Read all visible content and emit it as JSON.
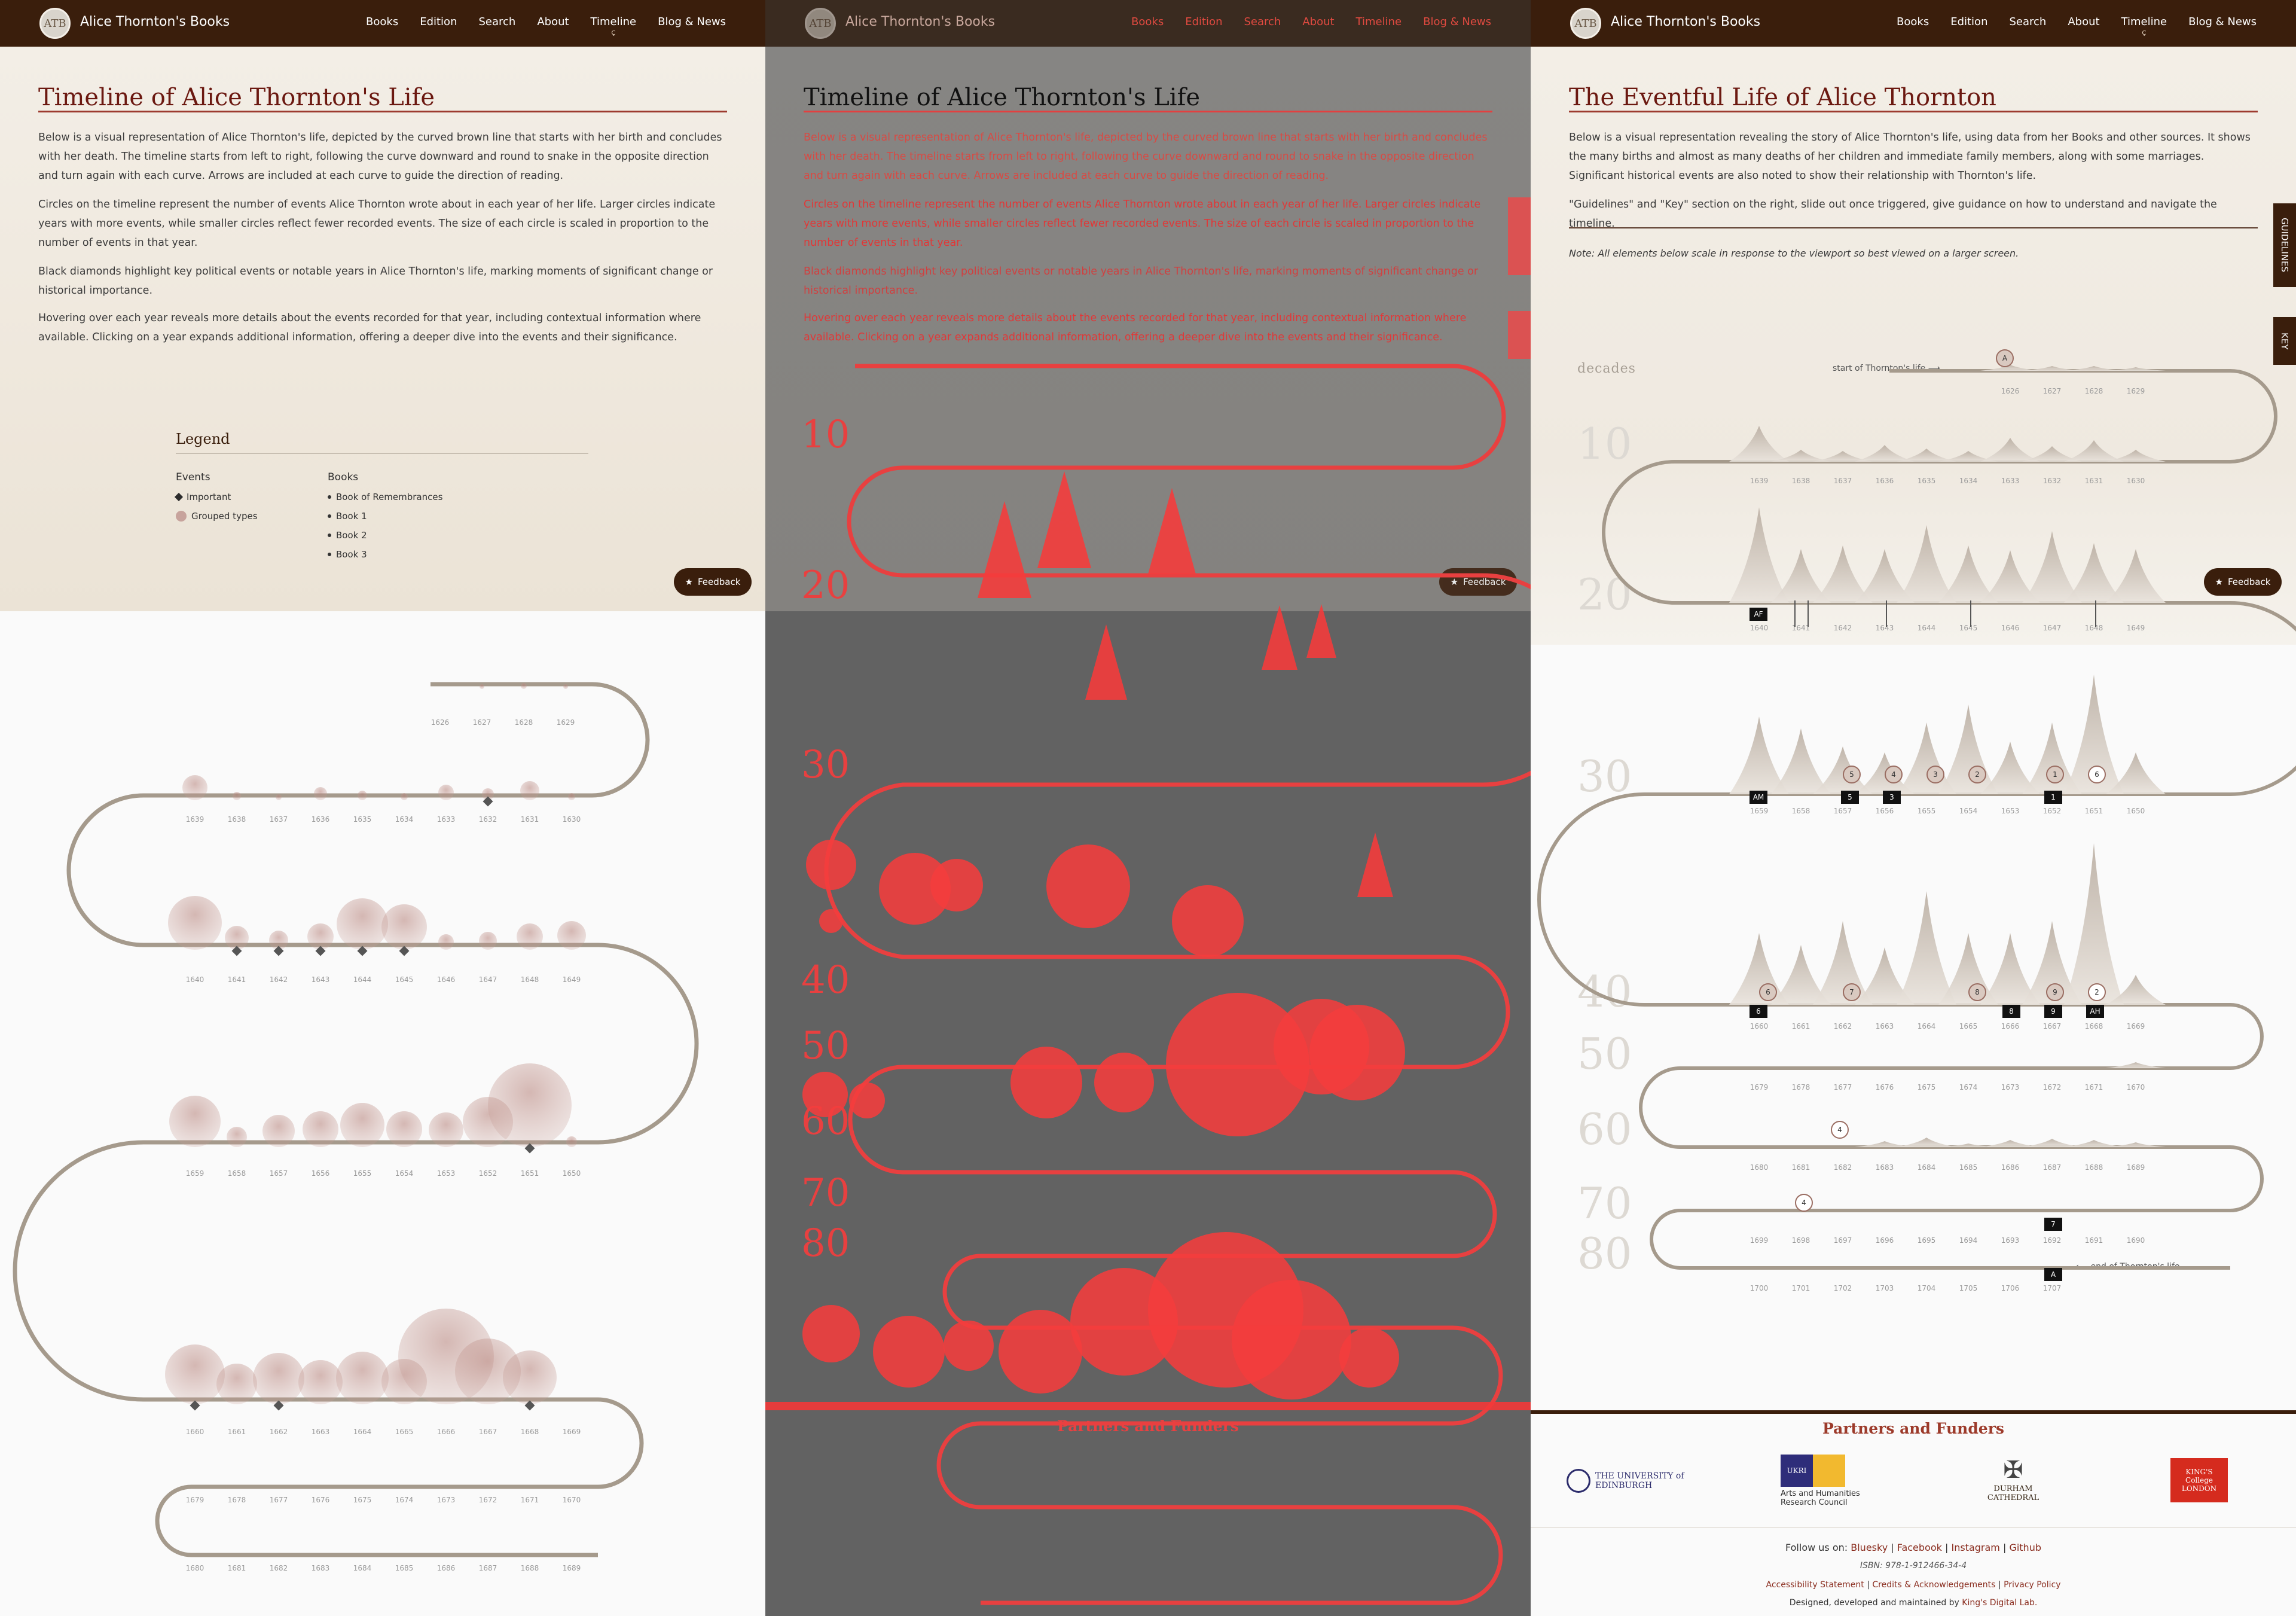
{
  "nav": {
    "brand": "Alice Thornton's Books",
    "logo": "ATB",
    "items": [
      "Books",
      "Edition",
      "Search",
      "About",
      "Timeline",
      "Blog & News"
    ],
    "current": "Timeline"
  },
  "p1": {
    "title": "Timeline of Alice Thornton's Life",
    "paras": [
      "Below is a visual representation of Alice Thornton's life, depicted by the curved brown line that starts with her birth and concludes with her death. The timeline starts from left to right, following the curve downward and round to snake in the opposite direction and turn again with each curve. Arrows are included at each curve to guide the direction of reading.",
      "Circles on the timeline represent the number of events Alice Thornton wrote about in each year of her life. Larger circles indicate years with more events, while smaller circles reflect fewer recorded events. The size of each circle is scaled in proportion to the number of events in that year.",
      "Black diamonds highlight key political events or notable years in Alice Thornton's life, marking moments of significant change or historical importance.",
      "Hovering over each year reveals more details about the events recorded for that year, including contextual information where available. Clicking on a year expands additional information, offering a deeper dive into the events and their significance."
    ],
    "legend": {
      "title": "Legend",
      "events_h": "Events",
      "books_h": "Books",
      "events": [
        "Important",
        "Grouped types"
      ],
      "books": [
        "Book of Remembrances",
        "Book 1",
        "Book 2",
        "Book 3"
      ]
    },
    "feedback": "Feedback"
  },
  "p3": {
    "title": "The Eventful Life of Alice Thornton",
    "paras": [
      "Below is a visual representation revealing the story of Alice Thornton's life, using data from her Books and other sources. It shows the many births and almost as many deaths of her children and immediate family members, along with some marriages. Significant historical events are also noted to show their relationship with Thornton's life.",
      "\"Guidelines\" and \"Key\" section on the right, slide out once triggered, give guidance on how to understand and navigate the timeline."
    ],
    "note": "Note: All elements below scale in response to the viewport so best viewed on a larger screen.",
    "tabs": [
      "GUIDELINES",
      "KEY"
    ],
    "decades_label": "decades",
    "start_label": "start of Thornton's life ⟶",
    "end_label": "⟵ end of Thornton's life",
    "decades": [
      "10",
      "20",
      "30",
      "40",
      "50",
      "60",
      "70",
      "80"
    ]
  },
  "footer": {
    "title": "Partners and Funders",
    "follow": "Follow us on:",
    "links": [
      "Bluesky",
      "Facebook",
      "Instagram",
      "Github"
    ],
    "isbn": "ISBN: 978-1-912466-34-4",
    "legal": [
      "Accessibility Statement",
      "Credits & Acknowledgements",
      "Privacy Policy"
    ],
    "designed": "Designed, developed and maintained by",
    "kdl": "King's Digital Lab.",
    "partners": [
      "THE UNIVERSITY of EDINBURGH",
      "Arts and Humanities Research Council",
      "DURHAM CATHEDRAL",
      "KING'S College LONDON"
    ],
    "ukri": "UKRI"
  },
  "timeline": {
    "rows": [
      [
        "1626",
        "1627",
        "1628",
        "1629"
      ],
      [
        "1639",
        "1638",
        "1637",
        "1636",
        "1635",
        "1634",
        "1633",
        "1632",
        "1631",
        "1630"
      ],
      [
        "1640",
        "1641",
        "1642",
        "1643",
        "1644",
        "1645",
        "1646",
        "1647",
        "1648",
        "1649"
      ],
      [
        "1659",
        "1658",
        "1657",
        "1656",
        "1655",
        "1654",
        "1653",
        "1652",
        "1651",
        "1650"
      ],
      [
        "1660",
        "1661",
        "1662",
        "1663",
        "1664",
        "1665",
        "1666",
        "1667",
        "1668",
        "1669"
      ],
      [
        "1679",
        "1678",
        "1677",
        "1676",
        "1675",
        "1674",
        "1673",
        "1672",
        "1671",
        "1670"
      ],
      [
        "1680",
        "1681",
        "1682",
        "1683",
        "1684",
        "1685",
        "1686",
        "1687",
        "1688",
        "1689"
      ],
      [
        "1699",
        "1698",
        "1697",
        "1696",
        "1695",
        "1694",
        "1693",
        "1692",
        "1691",
        "1690"
      ],
      [
        "1700",
        "1701",
        "1702",
        "1703",
        "1704",
        "1705",
        "1706",
        "1707"
      ]
    ],
    "p3_labels": {
      "row2": [
        "AF"
      ],
      "row3": [
        "AM",
        "5",
        "3",
        "1"
      ],
      "row3_circles": [
        "5",
        "4",
        "3",
        "2",
        "1",
        "6"
      ],
      "row4": [
        "6",
        "8",
        "9",
        "AH"
      ],
      "row4_circles": [
        "6",
        "7",
        "8",
        "9",
        "2"
      ],
      "row6": [
        "4"
      ],
      "row7": [
        "4",
        "7"
      ],
      "row8": [
        "A"
      ],
      "top": "A"
    }
  }
}
